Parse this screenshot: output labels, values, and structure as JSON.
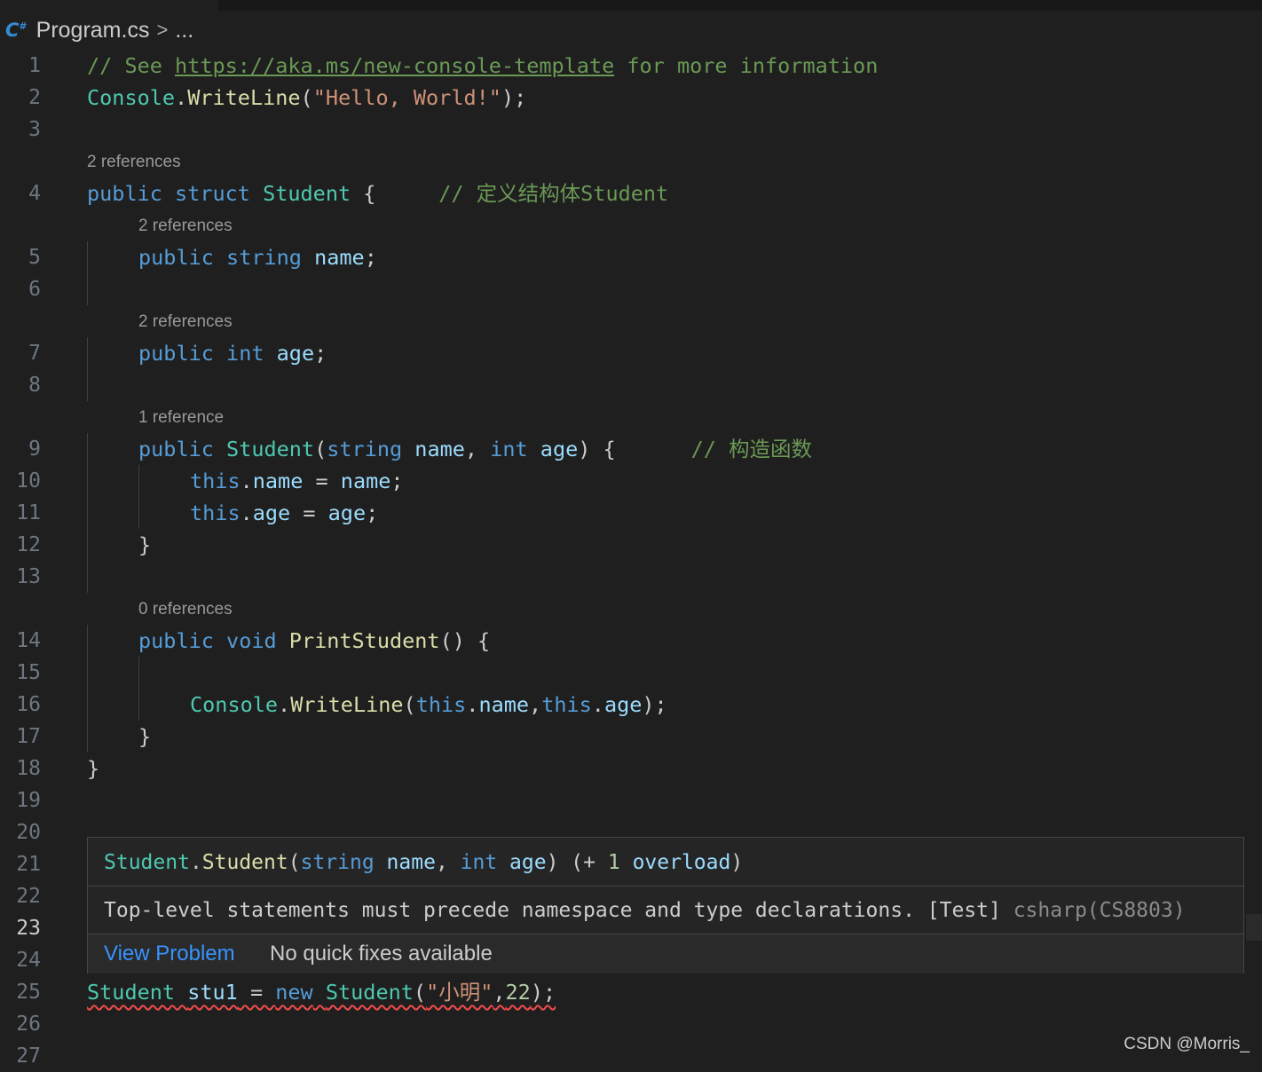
{
  "breadcrumb": {
    "icon": "csharp-file-icon",
    "file": "Program.cs",
    "separator": ">",
    "more": "..."
  },
  "gutter": {
    "line_numbers": [
      "1",
      "2",
      "3",
      "4",
      "5",
      "6",
      "7",
      "8",
      "9",
      "10",
      "11",
      "12",
      "13",
      "14",
      "15",
      "16",
      "17",
      "18",
      "19",
      "20",
      "21",
      "22",
      "23",
      "24",
      "25",
      "26",
      "27"
    ],
    "current_line": "23"
  },
  "codelens": {
    "struct": "2 references",
    "name_field": "2 references",
    "age_field": "2 references",
    "constructor": "1 reference",
    "print_method": "0 references"
  },
  "code": {
    "l1_comment": "// See ",
    "l1_link": "https://aka.ms/new-console-template",
    "l1_tail": " for more information",
    "console": "Console",
    "dot": ".",
    "writeline": "WriteLine",
    "l2_arg": "\"Hello, World!\"",
    "kw_public": "public",
    "kw_struct": "struct",
    "kw_string": "string",
    "kw_int": "int",
    "kw_void": "void",
    "kw_this": "this",
    "kw_new": "new",
    "type_student": "Student",
    "l4_comment": "// 定义结构体Student",
    "ident_name": "name",
    "ident_age": "age",
    "l9_comment": "// 构造函数",
    "fn_print": "PrintStudent",
    "var_stu1": "stu1",
    "l25_str": "\"小明\"",
    "l25_num": "22",
    "open_brace": "{",
    "close_brace": "}"
  },
  "hover": {
    "signature": {
      "type": "Student",
      "method": "Student",
      "param1_type": "string",
      "param1_name": "name",
      "param2_type": "int",
      "param2_name": "age",
      "overload_prefix": "(+ ",
      "overload_count": "1",
      "overload_word": "overload",
      "overload_suffix": ")"
    },
    "message": "Top-level statements must precede namespace and type declarations. [Test]",
    "error_code": "csharp(CS8803)",
    "view_problem": "View Problem",
    "quick_fix": "No quick fixes available"
  },
  "watermark": "CSDN @Morris_",
  "colors": {
    "background": "#1f1f1f",
    "keyword": "#569cd6",
    "type": "#4ec9b0",
    "function": "#dcdcaa",
    "variable": "#9cdcfe",
    "string": "#ce9178",
    "comment": "#6a9955",
    "number": "#b5cea8",
    "error": "#f14c4c",
    "link": "#3794ff"
  }
}
